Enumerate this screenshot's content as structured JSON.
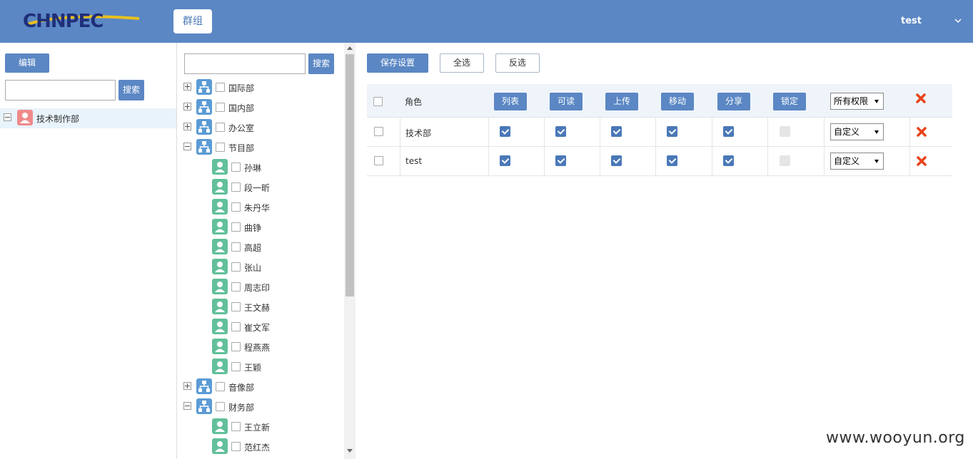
{
  "header": {
    "logo_text": "CHNPEC",
    "group_button": "群组",
    "user_name": "test"
  },
  "left": {
    "edit_button": "编辑",
    "search_button": "搜索",
    "search_value": "",
    "tree": [
      {
        "label": "技术制作部",
        "expanded": true,
        "selected": true
      }
    ]
  },
  "middle": {
    "search_button": "搜索",
    "search_value": "",
    "tree": [
      {
        "label": "国际部",
        "type": "org",
        "expand": "plus"
      },
      {
        "label": "国内部",
        "type": "org",
        "expand": "plus"
      },
      {
        "label": "办公室",
        "type": "org",
        "expand": "plus"
      },
      {
        "label": "节目部",
        "type": "org",
        "expand": "minus"
      },
      {
        "label": "孙琳",
        "type": "person"
      },
      {
        "label": "段一昕",
        "type": "person"
      },
      {
        "label": "朱丹华",
        "type": "person"
      },
      {
        "label": "曲铮",
        "type": "person"
      },
      {
        "label": "高超",
        "type": "person"
      },
      {
        "label": "张山",
        "type": "person"
      },
      {
        "label": "周志印",
        "type": "person"
      },
      {
        "label": "王文赫",
        "type": "person"
      },
      {
        "label": "崔文军",
        "type": "person"
      },
      {
        "label": "程燕燕",
        "type": "person"
      },
      {
        "label": "王颖",
        "type": "person"
      },
      {
        "label": "音像部",
        "type": "org",
        "expand": "plus"
      },
      {
        "label": "财务部",
        "type": "org",
        "expand": "minus"
      },
      {
        "label": "王立新",
        "type": "person"
      },
      {
        "label": "范红杰",
        "type": "person"
      }
    ]
  },
  "right": {
    "save_button": "保存设置",
    "select_all_button": "全选",
    "invert_button": "反选",
    "table": {
      "role_header": "角色",
      "permission_headers": [
        "列表",
        "可读",
        "上传",
        "移动",
        "分享",
        "锁定"
      ],
      "all_perm_select": "所有权限",
      "rows": [
        {
          "role": "技术部",
          "perms": [
            true,
            true,
            true,
            true,
            true,
            null
          ],
          "mode": "自定义"
        },
        {
          "role": "test",
          "perms": [
            true,
            true,
            true,
            true,
            true,
            null
          ],
          "mode": "自定义"
        }
      ]
    }
  },
  "watermark": "www.wooyun.org",
  "colors": {
    "header_bg": "#5b87c4",
    "accent": "#4a78b8",
    "delete": "#e8431b"
  }
}
